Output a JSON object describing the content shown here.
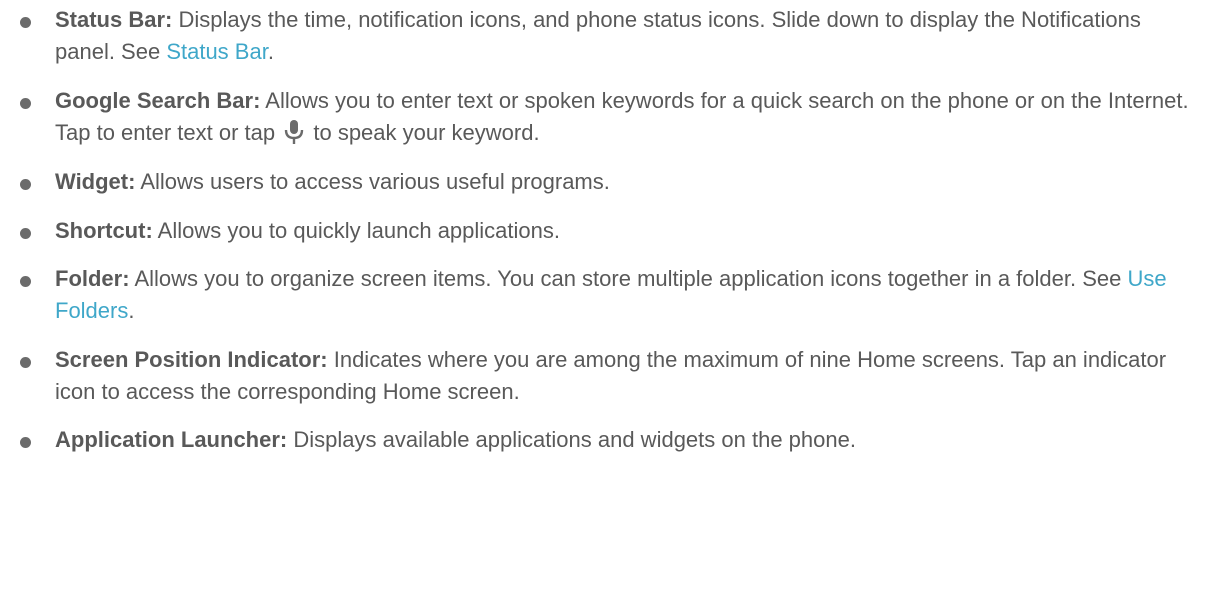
{
  "items": [
    {
      "term": "Status Bar:",
      "text": " Displays the time, notification icons, and phone status icons. Slide down to display the Notifications panel. See ",
      "link": "Status Bar",
      "after": "."
    },
    {
      "term": "Google Search Bar:",
      "text": " Allows you to enter text or spoken keywords for a quick search on the phone or on the Internet. Tap to enter text or tap ",
      "icon": "microphone-icon",
      "after": " to speak your keyword."
    },
    {
      "term": "Widget:",
      "text": " Allows users to access various useful programs."
    },
    {
      "term": "Shortcut:",
      "text": " Allows you to quickly launch applications."
    },
    {
      "term": "Folder:",
      "text": " Allows you to organize screen items. You can store multiple application icons together in a folder. See ",
      "link": "Use Folders",
      "after": "."
    },
    {
      "term": "Screen Position Indicator:",
      "text": " Indicates where you are among the maximum of nine Home screens. Tap an indicator icon to access the corresponding Home screen."
    },
    {
      "term": "Application Launcher:",
      "text": " Displays available applications and widgets on the phone."
    }
  ],
  "colors": {
    "text": "#595959",
    "link": "#3fa7c9",
    "icon": "#6b6b6b"
  }
}
